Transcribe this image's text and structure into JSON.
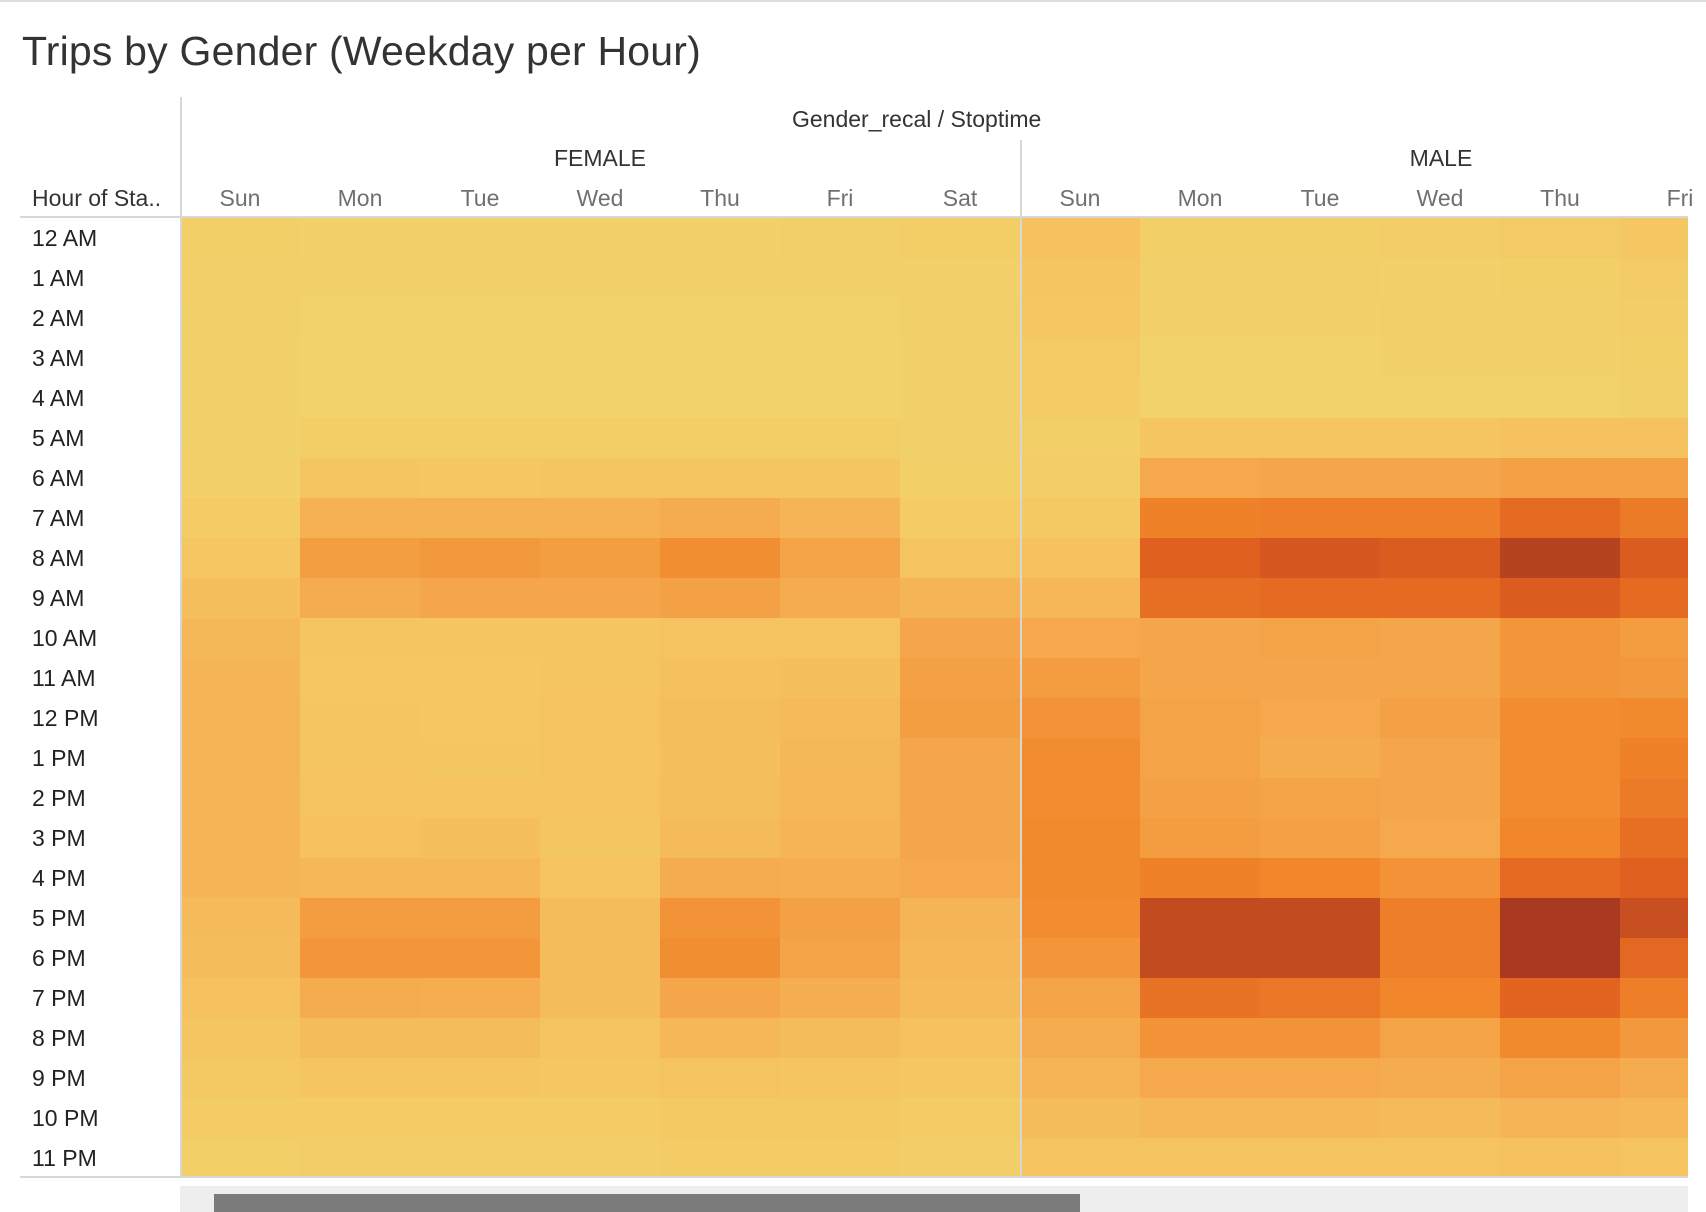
{
  "title": "Trips by Gender (Weekday per Hour)",
  "chart_data": {
    "type": "heatmap",
    "title": "Trips by Gender (Weekday per Hour)",
    "column_header": "Gender_recal / Stoptime",
    "row_header": "Hour of Sta..",
    "groups": [
      {
        "name": "FEMALE",
        "days": [
          "Sun",
          "Mon",
          "Tue",
          "Wed",
          "Thu",
          "Fri",
          "Sat"
        ]
      },
      {
        "name": "MALE",
        "days": [
          "Sun",
          "Mon",
          "Tue",
          "Wed",
          "Thu",
          "Fri"
        ]
      }
    ],
    "rows": [
      "12 AM",
      "1 AM",
      "2 AM",
      "3 AM",
      "4 AM",
      "5 AM",
      "6 AM",
      "7 AM",
      "8 AM",
      "9 AM",
      "10 AM",
      "11 AM",
      "12 PM",
      "1 PM",
      "2 PM",
      "3 PM",
      "4 PM",
      "5 PM",
      "6 PM",
      "7 PM",
      "8 PM",
      "9 PM",
      "10 PM",
      "11 PM"
    ],
    "intensity_scale": "0 = lightest (yellow), 1 = darkest (dark red)",
    "colors": {
      "low": "#f2d36b",
      "mid1": "#f5b45a",
      "mid2": "#f18a2e",
      "high": "#e06820",
      "max": "#a3361f"
    },
    "values": [
      [
        0.05,
        0.02,
        0.02,
        0.02,
        0.02,
        0.03,
        0.06,
        0.2,
        0.05,
        0.05,
        0.07,
        0.09,
        0.14
      ],
      [
        0.04,
        0.02,
        0.02,
        0.02,
        0.02,
        0.02,
        0.04,
        0.16,
        0.03,
        0.03,
        0.04,
        0.05,
        0.09
      ],
      [
        0.03,
        0.01,
        0.01,
        0.01,
        0.01,
        0.01,
        0.03,
        0.14,
        0.02,
        0.02,
        0.03,
        0.03,
        0.07
      ],
      [
        0.02,
        0.01,
        0.01,
        0.01,
        0.01,
        0.01,
        0.02,
        0.11,
        0.01,
        0.01,
        0.02,
        0.02,
        0.05
      ],
      [
        0.02,
        0.01,
        0.01,
        0.01,
        0.01,
        0.01,
        0.02,
        0.08,
        0.01,
        0.01,
        0.01,
        0.01,
        0.03
      ],
      [
        0.02,
        0.06,
        0.06,
        0.06,
        0.06,
        0.06,
        0.03,
        0.05,
        0.16,
        0.16,
        0.16,
        0.2,
        0.2
      ],
      [
        0.04,
        0.17,
        0.14,
        0.17,
        0.17,
        0.17,
        0.05,
        0.07,
        0.38,
        0.4,
        0.4,
        0.44,
        0.44
      ],
      [
        0.1,
        0.32,
        0.32,
        0.32,
        0.36,
        0.3,
        0.1,
        0.12,
        0.62,
        0.64,
        0.64,
        0.74,
        0.66
      ],
      [
        0.14,
        0.45,
        0.48,
        0.45,
        0.55,
        0.42,
        0.18,
        0.2,
        0.8,
        0.84,
        0.82,
        0.94,
        0.82
      ],
      [
        0.22,
        0.36,
        0.4,
        0.4,
        0.43,
        0.36,
        0.3,
        0.28,
        0.72,
        0.74,
        0.74,
        0.82,
        0.74
      ],
      [
        0.27,
        0.16,
        0.16,
        0.17,
        0.19,
        0.18,
        0.4,
        0.38,
        0.4,
        0.42,
        0.4,
        0.5,
        0.46
      ],
      [
        0.3,
        0.14,
        0.14,
        0.17,
        0.21,
        0.22,
        0.43,
        0.46,
        0.4,
        0.4,
        0.4,
        0.5,
        0.48
      ],
      [
        0.3,
        0.16,
        0.14,
        0.18,
        0.23,
        0.26,
        0.45,
        0.52,
        0.42,
        0.38,
        0.44,
        0.56,
        0.58
      ],
      [
        0.3,
        0.17,
        0.15,
        0.18,
        0.22,
        0.27,
        0.4,
        0.56,
        0.42,
        0.36,
        0.4,
        0.56,
        0.62
      ],
      [
        0.3,
        0.18,
        0.19,
        0.18,
        0.23,
        0.28,
        0.4,
        0.56,
        0.44,
        0.42,
        0.4,
        0.56,
        0.66
      ],
      [
        0.3,
        0.2,
        0.22,
        0.15,
        0.25,
        0.3,
        0.4,
        0.58,
        0.46,
        0.44,
        0.38,
        0.6,
        0.72
      ],
      [
        0.3,
        0.28,
        0.28,
        0.18,
        0.36,
        0.35,
        0.38,
        0.58,
        0.62,
        0.6,
        0.52,
        0.74,
        0.8
      ],
      [
        0.26,
        0.46,
        0.46,
        0.24,
        0.52,
        0.44,
        0.3,
        0.56,
        0.9,
        0.9,
        0.64,
        0.98,
        0.88
      ],
      [
        0.24,
        0.5,
        0.5,
        0.24,
        0.55,
        0.42,
        0.28,
        0.5,
        0.9,
        0.9,
        0.64,
        0.98,
        0.76
      ],
      [
        0.2,
        0.36,
        0.35,
        0.24,
        0.4,
        0.34,
        0.25,
        0.42,
        0.7,
        0.68,
        0.6,
        0.78,
        0.64
      ],
      [
        0.16,
        0.24,
        0.24,
        0.18,
        0.28,
        0.24,
        0.2,
        0.36,
        0.52,
        0.52,
        0.42,
        0.58,
        0.48
      ],
      [
        0.12,
        0.16,
        0.16,
        0.14,
        0.18,
        0.17,
        0.14,
        0.3,
        0.38,
        0.38,
        0.36,
        0.42,
        0.36
      ],
      [
        0.08,
        0.1,
        0.1,
        0.1,
        0.12,
        0.12,
        0.1,
        0.24,
        0.28,
        0.28,
        0.26,
        0.3,
        0.28
      ],
      [
        0.05,
        0.07,
        0.07,
        0.07,
        0.08,
        0.08,
        0.07,
        0.18,
        0.18,
        0.18,
        0.18,
        0.2,
        0.18
      ]
    ]
  },
  "scrollbar": {
    "position": 0.0,
    "visible_fraction": 0.6
  }
}
